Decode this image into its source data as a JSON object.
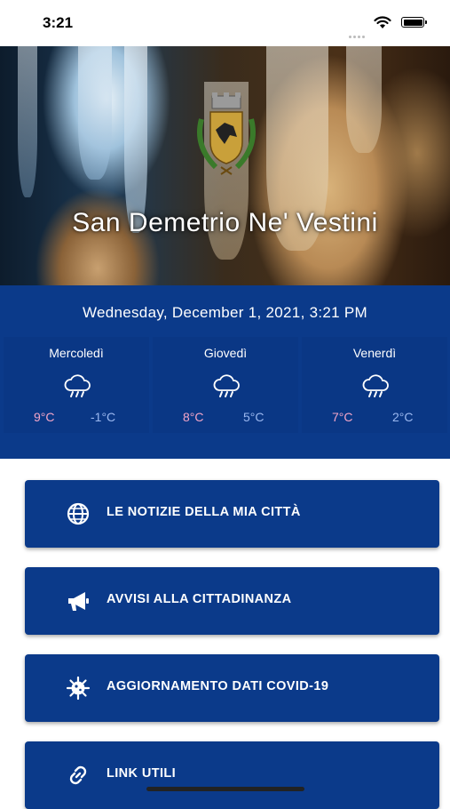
{
  "status_bar": {
    "time": "3:21"
  },
  "hero": {
    "title": "San Demetrio Ne' Vestini"
  },
  "weather": {
    "date": "Wednesday, December 1, 2021, 3:21 PM",
    "days": [
      {
        "name": "Mercoledì",
        "icon": "rain-cloud-icon",
        "max": "9°C",
        "min": "-1°C"
      },
      {
        "name": "Giovedì",
        "icon": "rain-cloud-icon",
        "max": "8°C",
        "min": "5°C"
      },
      {
        "name": "Venerdì",
        "icon": "rain-cloud-icon",
        "max": "7°C",
        "min": "2°C"
      }
    ]
  },
  "menu": [
    {
      "label": "LE NOTIZIE DELLA MIA CITTÀ",
      "icon": "globe-icon"
    },
    {
      "label": "AVVISI ALLA CITTADINANZA",
      "icon": "megaphone-icon"
    },
    {
      "label": "AGGIORNAMENTO DATI COVID-19",
      "icon": "virus-icon"
    },
    {
      "label": "LINK UTILI",
      "icon": "link-icon"
    }
  ],
  "colors": {
    "primary": "#0b3a8a",
    "max_temp": "#f4a6c8",
    "min_temp": "#9bb8f0"
  }
}
